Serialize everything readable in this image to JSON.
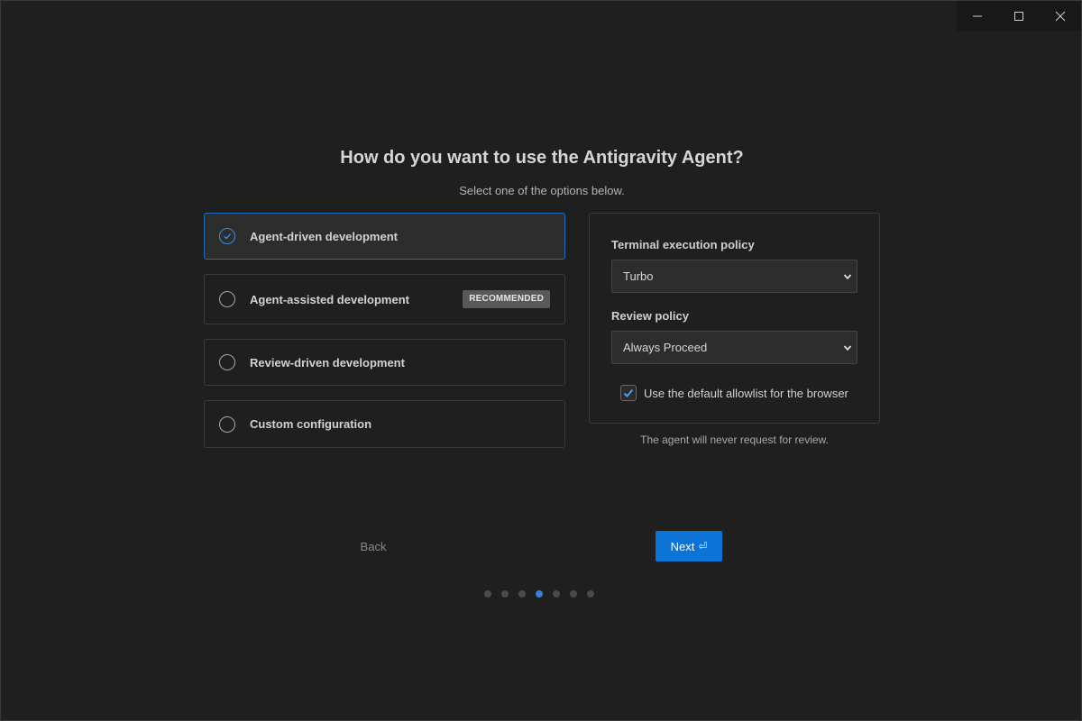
{
  "window": {
    "controls": [
      "minimize-icon",
      "maximize-icon",
      "close-icon"
    ]
  },
  "header": {
    "title": "How do you want to use the Antigravity Agent?",
    "subtitle": "Select one of the options below."
  },
  "options": [
    {
      "label": "Agent-driven development",
      "selected": true,
      "badge": ""
    },
    {
      "label": "Agent-assisted development",
      "selected": false,
      "badge": "RECOMMENDED"
    },
    {
      "label": "Review-driven development",
      "selected": false,
      "badge": ""
    },
    {
      "label": "Custom configuration",
      "selected": false,
      "badge": ""
    }
  ],
  "settings": {
    "terminal_label": "Terminal execution policy",
    "terminal_value": "Turbo",
    "review_label": "Review policy",
    "review_value": "Always Proceed",
    "allowlist_label": "Use the default allowlist for the browser",
    "allowlist_checked": true,
    "note": "The agent will never request for review."
  },
  "nav": {
    "back_label": "Back",
    "next_label": "Next",
    "next_icon": "⏎",
    "step_count": 7,
    "current_step": 4
  },
  "colors": {
    "accent": "#0d73d6",
    "selected_border": "#1f6fc0",
    "background": "#1f1f1f"
  }
}
